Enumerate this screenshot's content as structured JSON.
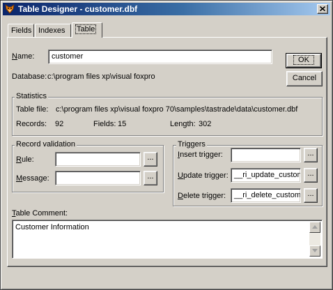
{
  "window": {
    "title": "Table Designer - customer.dbf"
  },
  "tabs": [
    {
      "label": "Fields"
    },
    {
      "label": "Indexes"
    },
    {
      "label": "Table"
    }
  ],
  "name": {
    "label": "Name:",
    "value": "customer"
  },
  "database": {
    "label": "Database:",
    "value": "c:\\program files xp\\visual foxpro"
  },
  "buttons": {
    "ok": "OK",
    "cancel": "Cancel",
    "ellipsis": "..."
  },
  "statistics": {
    "title": "Statistics",
    "table_file_label": "Table file:",
    "table_file_value": "c:\\program files xp\\visual foxpro 70\\samples\\tastrade\\data\\customer.dbf",
    "records_label": "Records:",
    "records_value": "92",
    "fields_label": "Fields:",
    "fields_value": "15",
    "length_label": "Length:",
    "length_value": "302"
  },
  "record_validation": {
    "title": "Record validation",
    "rule_label": "Rule:",
    "rule_value": "",
    "message_label": "Message:",
    "message_value": ""
  },
  "triggers": {
    "title": "Triggers",
    "insert_label": "Insert trigger:",
    "insert_value": "",
    "update_label": "Update trigger:",
    "update_value": "__ri_update_custon",
    "delete_label": "Delete trigger:",
    "delete_value": "__ri_delete_custom"
  },
  "comment": {
    "label": "Table Comment:",
    "value": "Customer Information"
  },
  "colors": {
    "title_start": "#0a246a",
    "title_end": "#a6caf0",
    "face": "#d4d0c8"
  },
  "icons": {
    "app": "foxpro-icon",
    "close": "close-icon"
  }
}
